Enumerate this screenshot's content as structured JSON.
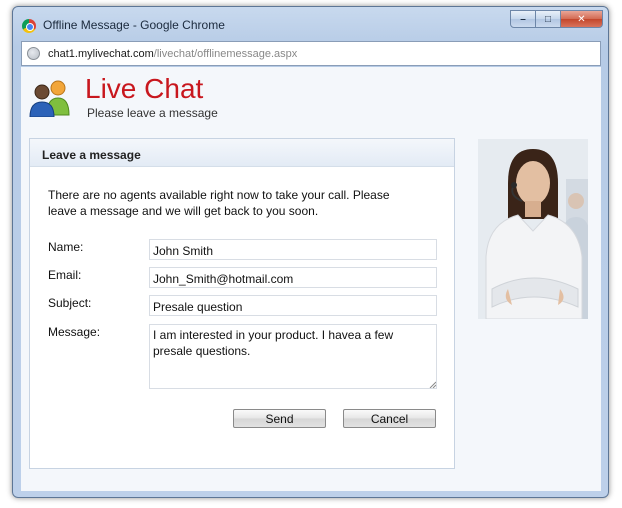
{
  "window": {
    "title": "Offline Message - Google Chrome",
    "controls": {
      "minimize": "–",
      "maximize": "□",
      "close": "✕"
    }
  },
  "address": {
    "host": "chat1.mylivechat.com",
    "path": "/livechat/offlinemessage.aspx"
  },
  "brand": {
    "title": "Live Chat",
    "subtitle": "Please leave a message"
  },
  "panel": {
    "header": "Leave a message",
    "intro": "There are no agents available right now to take your call. Please leave a message and we will get back to you soon."
  },
  "form": {
    "name_label": "Name:",
    "name_value": "John Smith",
    "email_label": "Email:",
    "email_value": "John_Smith@hotmail.com",
    "subject_label": "Subject:",
    "subject_value": "Presale question",
    "message_label": "Message:",
    "message_value": "I am interested in your product. I havea a few presale questions.",
    "send_label": "Send",
    "cancel_label": "Cancel"
  },
  "icons": {
    "browser": "chrome-icon",
    "site": "globe-icon",
    "logo": "users-icon"
  },
  "colors": {
    "brand_red": "#c8171e",
    "frame_blue": "#bdd0ea"
  }
}
